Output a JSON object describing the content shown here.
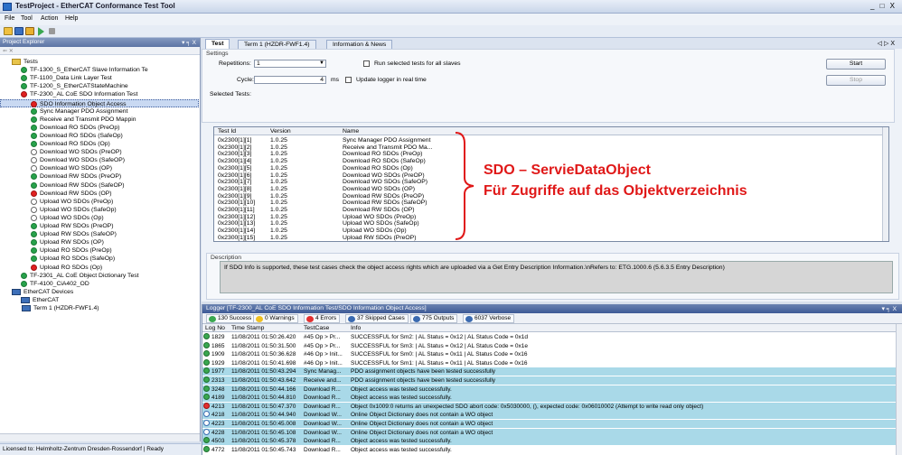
{
  "window": {
    "title": "TestProject - EtherCAT Conformance Test Tool",
    "controls": "_ □ X"
  },
  "menu": [
    "File",
    "Tool",
    "Action",
    "Help"
  ],
  "explorer": {
    "title": "Project Explorer",
    "pin": "▾ ╕ X",
    "tools": "⇐ ✕",
    "tree": [
      {
        "label": "Tests",
        "indent": 0,
        "icon": "folder",
        "exp": "⊟"
      },
      {
        "label": "TF-1300_S_EtherCAT Slave Information Te",
        "indent": 1,
        "icon": "green",
        "exp": "⊞"
      },
      {
        "label": "TF-1100_Data Link Layer Test",
        "indent": 1,
        "icon": "green",
        "exp": "⊞"
      },
      {
        "label": "TF-1200_S_EtherCATStateMachine",
        "indent": 1,
        "icon": "green",
        "exp": "⊞"
      },
      {
        "label": "TF-2300_AL CoE SDO Information Test",
        "indent": 1,
        "icon": "red",
        "exp": "⊟"
      },
      {
        "label": "SDO Information Object Access",
        "indent": 2,
        "icon": "red",
        "exp": "⊟",
        "sel": true
      },
      {
        "label": "Sync Manager PDO Assignment",
        "indent": 3,
        "icon": "green"
      },
      {
        "label": "Receive and Transmit PDO Mappin",
        "indent": 3,
        "icon": "green"
      },
      {
        "label": "Download RO SDOs (PreOp)",
        "indent": 3,
        "icon": "green"
      },
      {
        "label": "Download RO SDOs (SafeOp)",
        "indent": 3,
        "icon": "green"
      },
      {
        "label": "Download RO SDOs (Op)",
        "indent": 3,
        "icon": "green"
      },
      {
        "label": "Download WO SDOs (PreOP)",
        "indent": 3,
        "icon": "white"
      },
      {
        "label": "Download WO SDOs (SafeOP)",
        "indent": 3,
        "icon": "white"
      },
      {
        "label": "Download WO SDOs (OP)",
        "indent": 3,
        "icon": "white"
      },
      {
        "label": "Download RW SDOs (PreOP)",
        "indent": 3,
        "icon": "green"
      },
      {
        "label": "Download RW SDOs (SafeOP)",
        "indent": 3,
        "icon": "green"
      },
      {
        "label": "Download RW SDOs (OP)",
        "indent": 3,
        "icon": "red"
      },
      {
        "label": "Upload WO SDOs (PreOp)",
        "indent": 3,
        "icon": "white"
      },
      {
        "label": "Upload WO SDOs (SafeOp)",
        "indent": 3,
        "icon": "white"
      },
      {
        "label": "Upload WO SDOs (Op)",
        "indent": 3,
        "icon": "white"
      },
      {
        "label": "Upload RW SDOs (PreOP)",
        "indent": 3,
        "icon": "green"
      },
      {
        "label": "Upload RW SDOs (SafeOP)",
        "indent": 3,
        "icon": "green"
      },
      {
        "label": "Upload RW SDOs (OP)",
        "indent": 3,
        "icon": "green"
      },
      {
        "label": "Upload RO SDOs (PreOp)",
        "indent": 3,
        "icon": "green"
      },
      {
        "label": "Upload RO SDOs (SafeOp)",
        "indent": 3,
        "icon": "green"
      },
      {
        "label": "Upload RO SDOs (Op)",
        "indent": 3,
        "icon": "red"
      },
      {
        "label": "TF-2301_AL CoE Object Dictionary Test",
        "indent": 1,
        "icon": "green",
        "exp": "⊞"
      },
      {
        "label": "TF-4100_CiA402_OD",
        "indent": 1,
        "icon": "green",
        "exp": "⊞"
      },
      {
        "label": "EtherCAT Devices",
        "indent": 0,
        "icon": "dev",
        "exp": "⊟"
      },
      {
        "label": "EtherCAT",
        "indent": 1,
        "icon": "dev",
        "exp": "⊟"
      },
      {
        "label": "Term 1 (HZDR-FWF1.4)",
        "indent": 2,
        "icon": "dev"
      }
    ]
  },
  "tabs": [
    {
      "label": "Test",
      "active": true
    },
    {
      "label": "Term 1 (HZDR-FWF1.4)",
      "active": false
    },
    {
      "label": "Information & News",
      "active": false
    }
  ],
  "tabnav": "◁ ▷ X",
  "settings": {
    "group": "Settings",
    "repetitions_label": "Repetitions:",
    "repetitions_value": "1",
    "cycle_label": "Cycle:",
    "cycle_value": "4",
    "cycle_unit": "ms",
    "run_all_label": "Run selected tests for all slaves",
    "update_label": "Update logger in real time",
    "start": "Start",
    "stop": "Stop"
  },
  "selected_tests": {
    "label": "Selected Tests:",
    "headers": [
      "Test Id",
      "Version",
      "Name"
    ],
    "rows": [
      [
        "0x2300[1][1]",
        "1.0.25",
        "Sync Manager PDO Assignment"
      ],
      [
        "0x2300[1][2]",
        "1.0.25",
        "Receive and Transmit PDO Ma..."
      ],
      [
        "0x2300[1][3]",
        "1.0.25",
        "Download RO SDOs (PreOp)"
      ],
      [
        "0x2300[1][4]",
        "1.0.25",
        "Download RO SDOs (SafeOp)"
      ],
      [
        "0x2300[1][5]",
        "1.0.25",
        "Download RO SDOs (Op)"
      ],
      [
        "0x2300[1][6]",
        "1.0.25",
        "Download WO SDOs (PreOP)"
      ],
      [
        "0x2300[1][7]",
        "1.0.25",
        "Download WO SDOs (SafeOP)"
      ],
      [
        "0x2300[1][8]",
        "1.0.25",
        "Download WO SDOs (OP)"
      ],
      [
        "0x2300[1][9]",
        "1.0.25",
        "Download RW SDOs (PreOP)"
      ],
      [
        "0x2300[1][10]",
        "1.0.25",
        "Download RW SDOs (SafeOP)"
      ],
      [
        "0x2300[1][11]",
        "1.0.25",
        "Download RW SDOs (OP)"
      ],
      [
        "0x2300[1][12]",
        "1.0.25",
        "Upload WO SDOs (PreOp)"
      ],
      [
        "0x2300[1][13]",
        "1.0.25",
        "Upload WO SDOs (SafeOp)"
      ],
      [
        "0x2300[1][14]",
        "1.0.25",
        "Upload WO SDOs (Op)"
      ],
      [
        "0x2300[1][15]",
        "1.0.25",
        "Upload RW SDOs (PreOP)"
      ]
    ]
  },
  "annotation": {
    "line1": "SDO – ServieDataObject",
    "line2": "Für Zugriffe auf das Objektverzeichnis"
  },
  "description": {
    "label": "Description",
    "text": "If SDO Info is supported, these test cases check the object access rights which are uploaded via a Get Entry Description Information.\\nRefers to: ETG.1000.6 (5.6.3.5 Entry Description)"
  },
  "logger": {
    "title": "Logger [TF-2300_AL CoE SDO Information Test/SDO Information Object Access]",
    "pin": "▾ ╕ X",
    "filters": [
      {
        "label": "130 Success",
        "color": "#3aa850"
      },
      {
        "label": "0 Warnings",
        "color": "#f0c020"
      },
      {
        "label": "4 Errors",
        "color": "#e23030"
      },
      {
        "label": "37 Skipped Cases",
        "color": "#3a6ab0"
      },
      {
        "label": "775 Outputs",
        "color": "#3a6ab0"
      },
      {
        "label": "6037 Verbose",
        "color": "#3a6ab0"
      }
    ],
    "headers": [
      "Log No",
      "Time Stamp",
      "TestCase",
      "Info"
    ],
    "rows": [
      {
        "no": "1829",
        "ts": "11/08/2011 01:50:26.420",
        "tc": "#45 Op > Pr...",
        "info": "SUCCESSFUL for Sm2: | AL Status = 0x12 | AL Status Code = 0x1d",
        "s": "ok",
        "hl": false
      },
      {
        "no": "1865",
        "ts": "11/08/2011 01:50:31.500",
        "tc": "#45 Op > Pr...",
        "info": "SUCCESSFUL for Sm3: | AL Status = 0x12 | AL Status Code = 0x1e",
        "s": "ok",
        "hl": false
      },
      {
        "no": "1909",
        "ts": "11/08/2011 01:50:36.628",
        "tc": "#46 Op > Init...",
        "info": "SUCCESSFUL for Sm0: | AL Status = 0x11 | AL Status Code = 0x16",
        "s": "ok",
        "hl": false
      },
      {
        "no": "1929",
        "ts": "11/08/2011 01:50:41.698",
        "tc": "#46 Op > Init...",
        "info": "SUCCESSFUL for Sm1: | AL Status = 0x11 | AL Status Code = 0x16",
        "s": "ok",
        "hl": false
      },
      {
        "no": "1977",
        "ts": "11/08/2011 01:50:43.294",
        "tc": "Sync Manag...",
        "info": "PDO assignment objects have been tested successfully",
        "s": "ok",
        "hl": true
      },
      {
        "no": "2313",
        "ts": "11/08/2011 01:50:43.642",
        "tc": "Receive and...",
        "info": "PDO assignment objects have been tested successfully",
        "s": "ok",
        "hl": true
      },
      {
        "no": "3248",
        "ts": "11/08/2011 01:50:44.166",
        "tc": "Download R...",
        "info": "Object access was tested successfully.",
        "s": "ok",
        "hl": true
      },
      {
        "no": "4189",
        "ts": "11/08/2011 01:50:44.810",
        "tc": "Download R...",
        "info": "Object access was tested successfully.",
        "s": "ok",
        "hl": true
      },
      {
        "no": "4213",
        "ts": "11/08/2011 01:50:47.370",
        "tc": "Download R...",
        "info": "Object 0x1009:0 returns an unexpected SDO abort code: 0x5030000, (), expected code: 0x06010002 (Attempt to write read only object)",
        "s": "err",
        "hl": true
      },
      {
        "no": "4218",
        "ts": "11/08/2011 01:50:44.940",
        "tc": "Download W...",
        "info": "Online Object Dictionary does not contain a WO object",
        "s": "skip",
        "hl": true
      },
      {
        "no": "4223",
        "ts": "11/08/2011 01:50:45.008",
        "tc": "Download W...",
        "info": "Online Object Dictionary does not contain a WO object",
        "s": "skip",
        "hl": true
      },
      {
        "no": "4228",
        "ts": "11/08/2011 01:50:45.108",
        "tc": "Download W...",
        "info": "Online Object Dictionary does not contain a WO object",
        "s": "skip",
        "hl": true
      },
      {
        "no": "4503",
        "ts": "11/08/2011 01:50:45.378",
        "tc": "Download R...",
        "info": "Object access was tested successfully.",
        "s": "ok",
        "hl": true
      },
      {
        "no": "4772",
        "ts": "11/08/2011 01:50:45.743",
        "tc": "Download R...",
        "info": "Object access was tested successfully.",
        "s": "ok",
        "hl": false
      }
    ]
  },
  "status": "Licensed to: Helmholtz-Zentrum Dresden-Rossendorf | Ready"
}
